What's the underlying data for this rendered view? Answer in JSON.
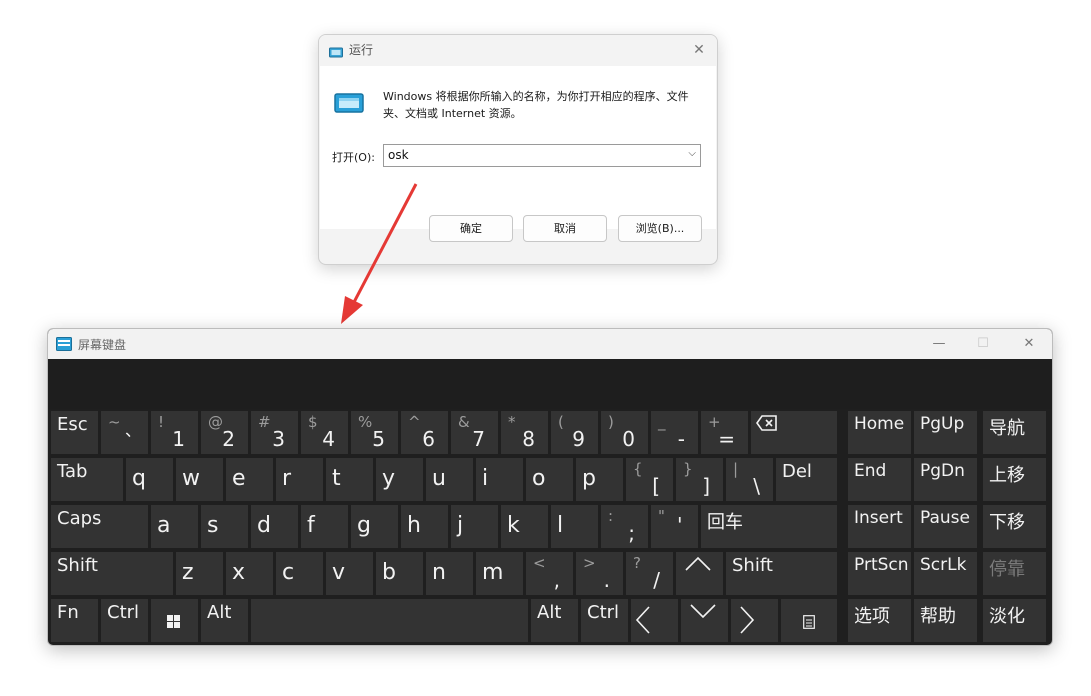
{
  "run_dialog": {
    "title": "运行",
    "description": "Windows 将根据你所输入的名称，为你打开相应的程序、文件夹、文档或 Internet 资源。",
    "open_label": "打开(O):",
    "input_value": "osk",
    "ok_label": "确定",
    "cancel_label": "取消",
    "browse_label": "浏览(B)..."
  },
  "osk": {
    "title": "屏幕键盘",
    "minimize_icon": "minimize-icon",
    "maximize_icon": "maximize-icon",
    "close_icon": "close-icon",
    "row1": [
      {
        "top": "",
        "main": "Esc"
      },
      {
        "top": "~",
        "main": "、"
      },
      {
        "top": "!",
        "main": "1"
      },
      {
        "top": "@",
        "main": "2"
      },
      {
        "top": "#",
        "main": "3"
      },
      {
        "top": "$",
        "main": "4"
      },
      {
        "top": "%",
        "main": "5"
      },
      {
        "top": "^",
        "main": "6"
      },
      {
        "top": "&",
        "main": "7"
      },
      {
        "top": "*",
        "main": "8"
      },
      {
        "top": "(",
        "main": "9"
      },
      {
        "top": ")",
        "main": "0"
      },
      {
        "top": "_",
        "main": "-"
      },
      {
        "top": "+",
        "main": "="
      }
    ],
    "backspace_icon": "backspace-icon",
    "row2": [
      "Tab",
      "q",
      "w",
      "e",
      "r",
      "t",
      "y",
      "u",
      "i",
      "o",
      "p"
    ],
    "row2_brackets": [
      {
        "top": "{",
        "main": "["
      },
      {
        "top": "}",
        "main": "]"
      },
      {
        "top": "|",
        "main": "\\"
      }
    ],
    "del_label": "Del",
    "row3": [
      "Caps",
      "a",
      "s",
      "d",
      "f",
      "g",
      "h",
      "j",
      "k",
      "l"
    ],
    "row3_punct": [
      {
        "top": ":",
        "main": ";"
      },
      {
        "top": "\"",
        "main": "'"
      }
    ],
    "enter_label": "回车",
    "row4_shift": "Shift",
    "row4": [
      "z",
      "x",
      "c",
      "v",
      "b",
      "n",
      "m"
    ],
    "row4_punct": [
      {
        "top": "<",
        "main": ","
      },
      {
        "top": ">",
        "main": "."
      },
      {
        "top": "?",
        "main": "/"
      }
    ],
    "row4_shift_right": "Shift",
    "row5": {
      "fn": "Fn",
      "ctrl": "Ctrl",
      "alt": "Alt",
      "alt_r": "Alt",
      "ctrl_r": "Ctrl"
    },
    "nav": {
      "home": "Home",
      "pgup": "PgUp",
      "nav": "导航",
      "end": "End",
      "pgdn": "PgDn",
      "up": "上移",
      "insert": "Insert",
      "pause": "Pause",
      "down": "下移",
      "prtscn": "PrtScn",
      "scrlk": "ScrLk",
      "dock": "停靠",
      "options": "选项",
      "help": "帮助",
      "fade": "淡化"
    }
  },
  "colors": {
    "arrow": "#e53935",
    "key_bg": "#333333",
    "keyboard_bg": "#1f1f1f",
    "accent_icon": "#1a8fc7"
  }
}
